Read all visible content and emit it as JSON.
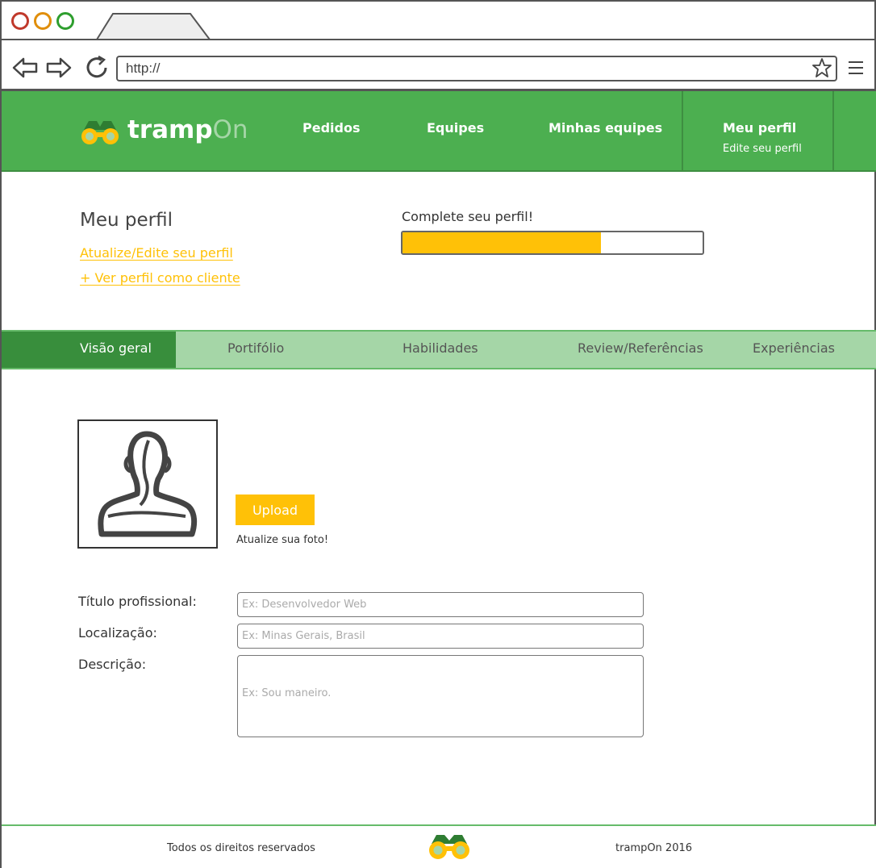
{
  "browser": {
    "url": "http://",
    "window_buttons": [
      "close",
      "minimize",
      "maximize"
    ],
    "colors": {
      "close": "#c0392b",
      "minimize": "#e08e0b",
      "maximize": "#2e9e2e"
    }
  },
  "header": {
    "logo": {
      "text_main": "tramp",
      "text_accent": "On",
      "icon": "binoculars-icon"
    },
    "nav": [
      {
        "label": "Pedidos"
      },
      {
        "label": "Equipes"
      },
      {
        "label": "Minhas equipes"
      }
    ],
    "active_nav": {
      "label": "Meu perfil",
      "sublabel": "Edite seu perfil"
    },
    "colors": {
      "background": "#4caf50",
      "accent": "#ffc107"
    }
  },
  "profile": {
    "title": "Meu perfil",
    "links": [
      {
        "label": "Atualize/Edite seu perfil"
      },
      {
        "label": "+ Ver perfil como cliente"
      }
    ],
    "completion": {
      "label": "Complete seu perfil!",
      "progress": 0.66
    }
  },
  "tabs": [
    {
      "label": "Visão geral",
      "active": true
    },
    {
      "label": "Portifólio",
      "active": false
    },
    {
      "label": "Habilidades",
      "active": false
    },
    {
      "label": "Review/Referências",
      "active": false
    },
    {
      "label": "Experiências",
      "active": false
    }
  ],
  "photo": {
    "upload_label": "Upload",
    "hint": "Atualize sua foto!",
    "icon": "user-silhouette-icon"
  },
  "form": {
    "fields": [
      {
        "label": "Título profissional:",
        "placeholder": "Ex: Desenvolvedor Web",
        "value": ""
      },
      {
        "label": "Localização:",
        "placeholder": "Ex: Minas Gerais, Brasil",
        "value": ""
      },
      {
        "label": "Descrição:",
        "placeholder": "Ex: Sou maneiro.",
        "value": ""
      }
    ]
  },
  "footer": {
    "left": "Todos os direitos reservados",
    "right": "trampOn 2016",
    "icon": "binoculars-icon"
  }
}
